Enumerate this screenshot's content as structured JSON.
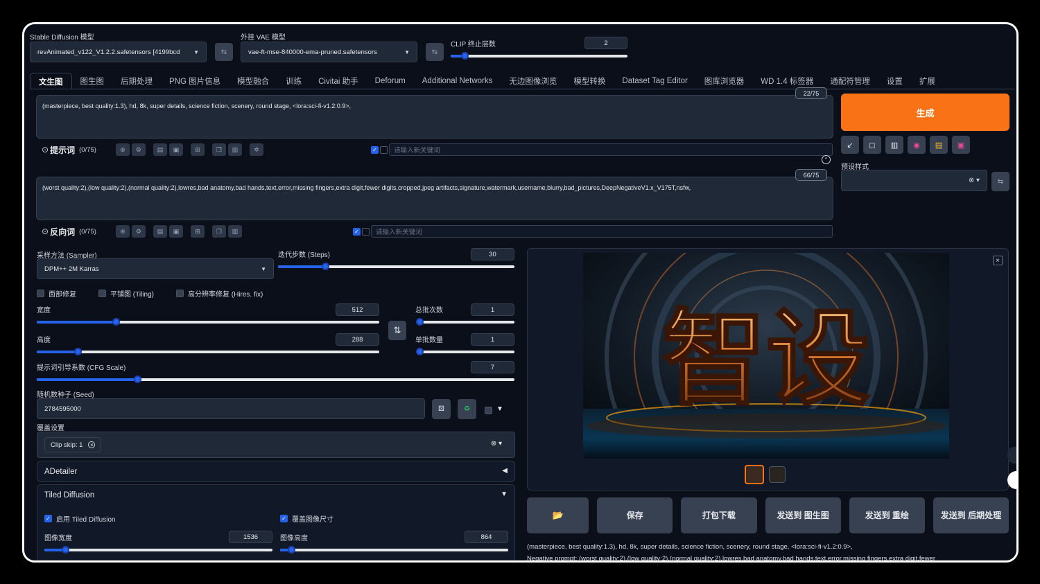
{
  "top": {
    "sd_model_label": "Stable Diffusion 模型",
    "sd_model_value": "revAnimated_v122_V1.2.2.safetensors [4199bcd",
    "vae_label": "外挂 VAE 模型",
    "vae_value": "vae-ft-mse-840000-ema-pruned.safetensors",
    "clip_label": "CLIP 终止层数",
    "clip_value": "2",
    "clip_fraction": 0.08
  },
  "tabs": [
    {
      "label": "文生图"
    },
    {
      "label": "图生图"
    },
    {
      "label": "后期处理"
    },
    {
      "label": "PNG 图片信息"
    },
    {
      "label": "模型融合"
    },
    {
      "label": "训练"
    },
    {
      "label": "Civitai 助手"
    },
    {
      "label": "Deforum"
    },
    {
      "label": "Additional Networks"
    },
    {
      "label": "无边图像浏览"
    },
    {
      "label": "模型转换"
    },
    {
      "label": "Dataset Tag Editor"
    },
    {
      "label": "图库浏览器"
    },
    {
      "label": "WD 1.4 标签器"
    },
    {
      "label": "通配符管理"
    },
    {
      "label": "设置"
    },
    {
      "label": "扩展"
    }
  ],
  "prompt": {
    "text": "(masterpiece, best quality:1.3), hd, 8k, super details, science fiction, scenery, round stage, <lora:sci-fi-v1.2:0.9>,",
    "counter": "22/75",
    "label": "提示词",
    "count": "(0/75)",
    "kw_placeholder": "请输入新关键词"
  },
  "negative": {
    "text": "(worst quality:2),(low quality:2),(normal quality:2),lowres,bad anatomy,bad hands,text,error,missing fingers,extra digit,fewer digits,cropped,jpeg artifacts,signature,watermark,username,blurry,bad_pictures,DeepNegativeV1.x_V175T,nsfw,",
    "counter": "66/75",
    "label": "反向词",
    "count": "(0/75)",
    "kw_placeholder": "请输入新关键词"
  },
  "generate": {
    "label": "生成",
    "preset_label": "预设样式"
  },
  "params": {
    "sampler_label": "采样方法 (Sampler)",
    "sampler_value": "DPM++ 2M Karras",
    "steps_label": "迭代步数 (Steps)",
    "steps_value": "30",
    "steps_fraction": 0.2,
    "face_restore": "面部修复",
    "tiling": "平铺图 (Tiling)",
    "hires": "高分辨率修复 (Hires. fix)",
    "width_label": "宽度",
    "width_value": "512",
    "width_fraction": 0.23,
    "height_label": "高度",
    "height_value": "288",
    "height_fraction": 0.12,
    "batch_count_label": "总批次数",
    "batch_count_value": "1",
    "batch_count_fraction": 0.0,
    "batch_size_label": "单批数量",
    "batch_size_value": "1",
    "batch_size_fraction": 0.0,
    "cfg_label": "提示词引导系数 (CFG Scale)",
    "cfg_value": "7",
    "cfg_fraction": 0.21,
    "seed_label": "随机数种子 (Seed)",
    "seed_value": "2784595000",
    "override_label": "覆盖设置",
    "override_chip": "Clip skip: 1"
  },
  "accordions": {
    "adetailer": "ADetailer",
    "tiled": "Tiled Diffusion",
    "enable_tiled": "启用 Tiled Diffusion",
    "override_size": "覆盖图像尺寸",
    "img_width_label": "图像宽度",
    "img_width_value": "1536",
    "img_width_fraction": 0.09,
    "img_height_label": "图像高度",
    "img_height_value": "864",
    "img_height_fraction": 0.05
  },
  "output": {
    "image_text": "智设",
    "buttons": [
      {
        "label": "",
        "icon": "folder-icon"
      },
      {
        "label": "保存"
      },
      {
        "label": "打包下载"
      },
      {
        "label": "发送到 图生图"
      },
      {
        "label": "发送到 重绘"
      },
      {
        "label": "发送到 后期处理"
      }
    ],
    "info_line1": "(masterpiece, best quality:1.3), hd, 8k, super details, science fiction, scenery, round stage, <lora:sci-fi-v1.2:0.9>,",
    "info_line2": "Negative prompt: (worst quality:2),(low quality:2),(normal quality:2),lowres,bad anatomy,bad hands,text,error,missing fingers,extra digit,fewer"
  },
  "colors": {
    "accent": "#2563eb",
    "generate": "#f97316",
    "bg": "#0b0f19"
  }
}
